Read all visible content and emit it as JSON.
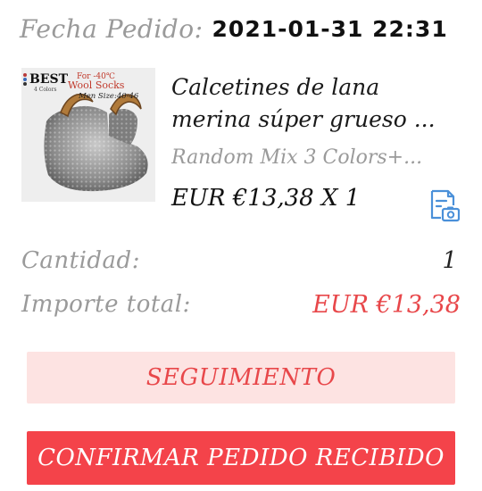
{
  "order": {
    "date_label": "Fecha Pedido:",
    "date_value": "2021-01-31 22:31"
  },
  "product": {
    "image_badge": {
      "best": "BEST",
      "colors": "4 Colors",
      "temp": "For -40℃",
      "name": "Wool Socks",
      "size": "Men Size:40-46"
    },
    "title_line1": "Calcetines de lana",
    "title_line2": "merina súper grueso ...",
    "variant": "Random Mix 3 Colors+...",
    "price_line": "EUR €13,38 X 1",
    "snapshot_icon": "document-camera-icon"
  },
  "summary": {
    "quantity_label": "Cantidad:",
    "quantity_value": "1",
    "total_label": "Importe total:",
    "total_value": "EUR €13,38"
  },
  "actions": {
    "track_label": "SEGUIMIENTO",
    "confirm_label": "CONFIRMAR PEDIDO RECIBIDO"
  },
  "colors": {
    "accent_red": "#e8474a",
    "button_red": "#f4434a",
    "button_pink": "#fde3e2",
    "muted_gray": "#9a9a9a",
    "icon_blue": "#4a90d9"
  }
}
